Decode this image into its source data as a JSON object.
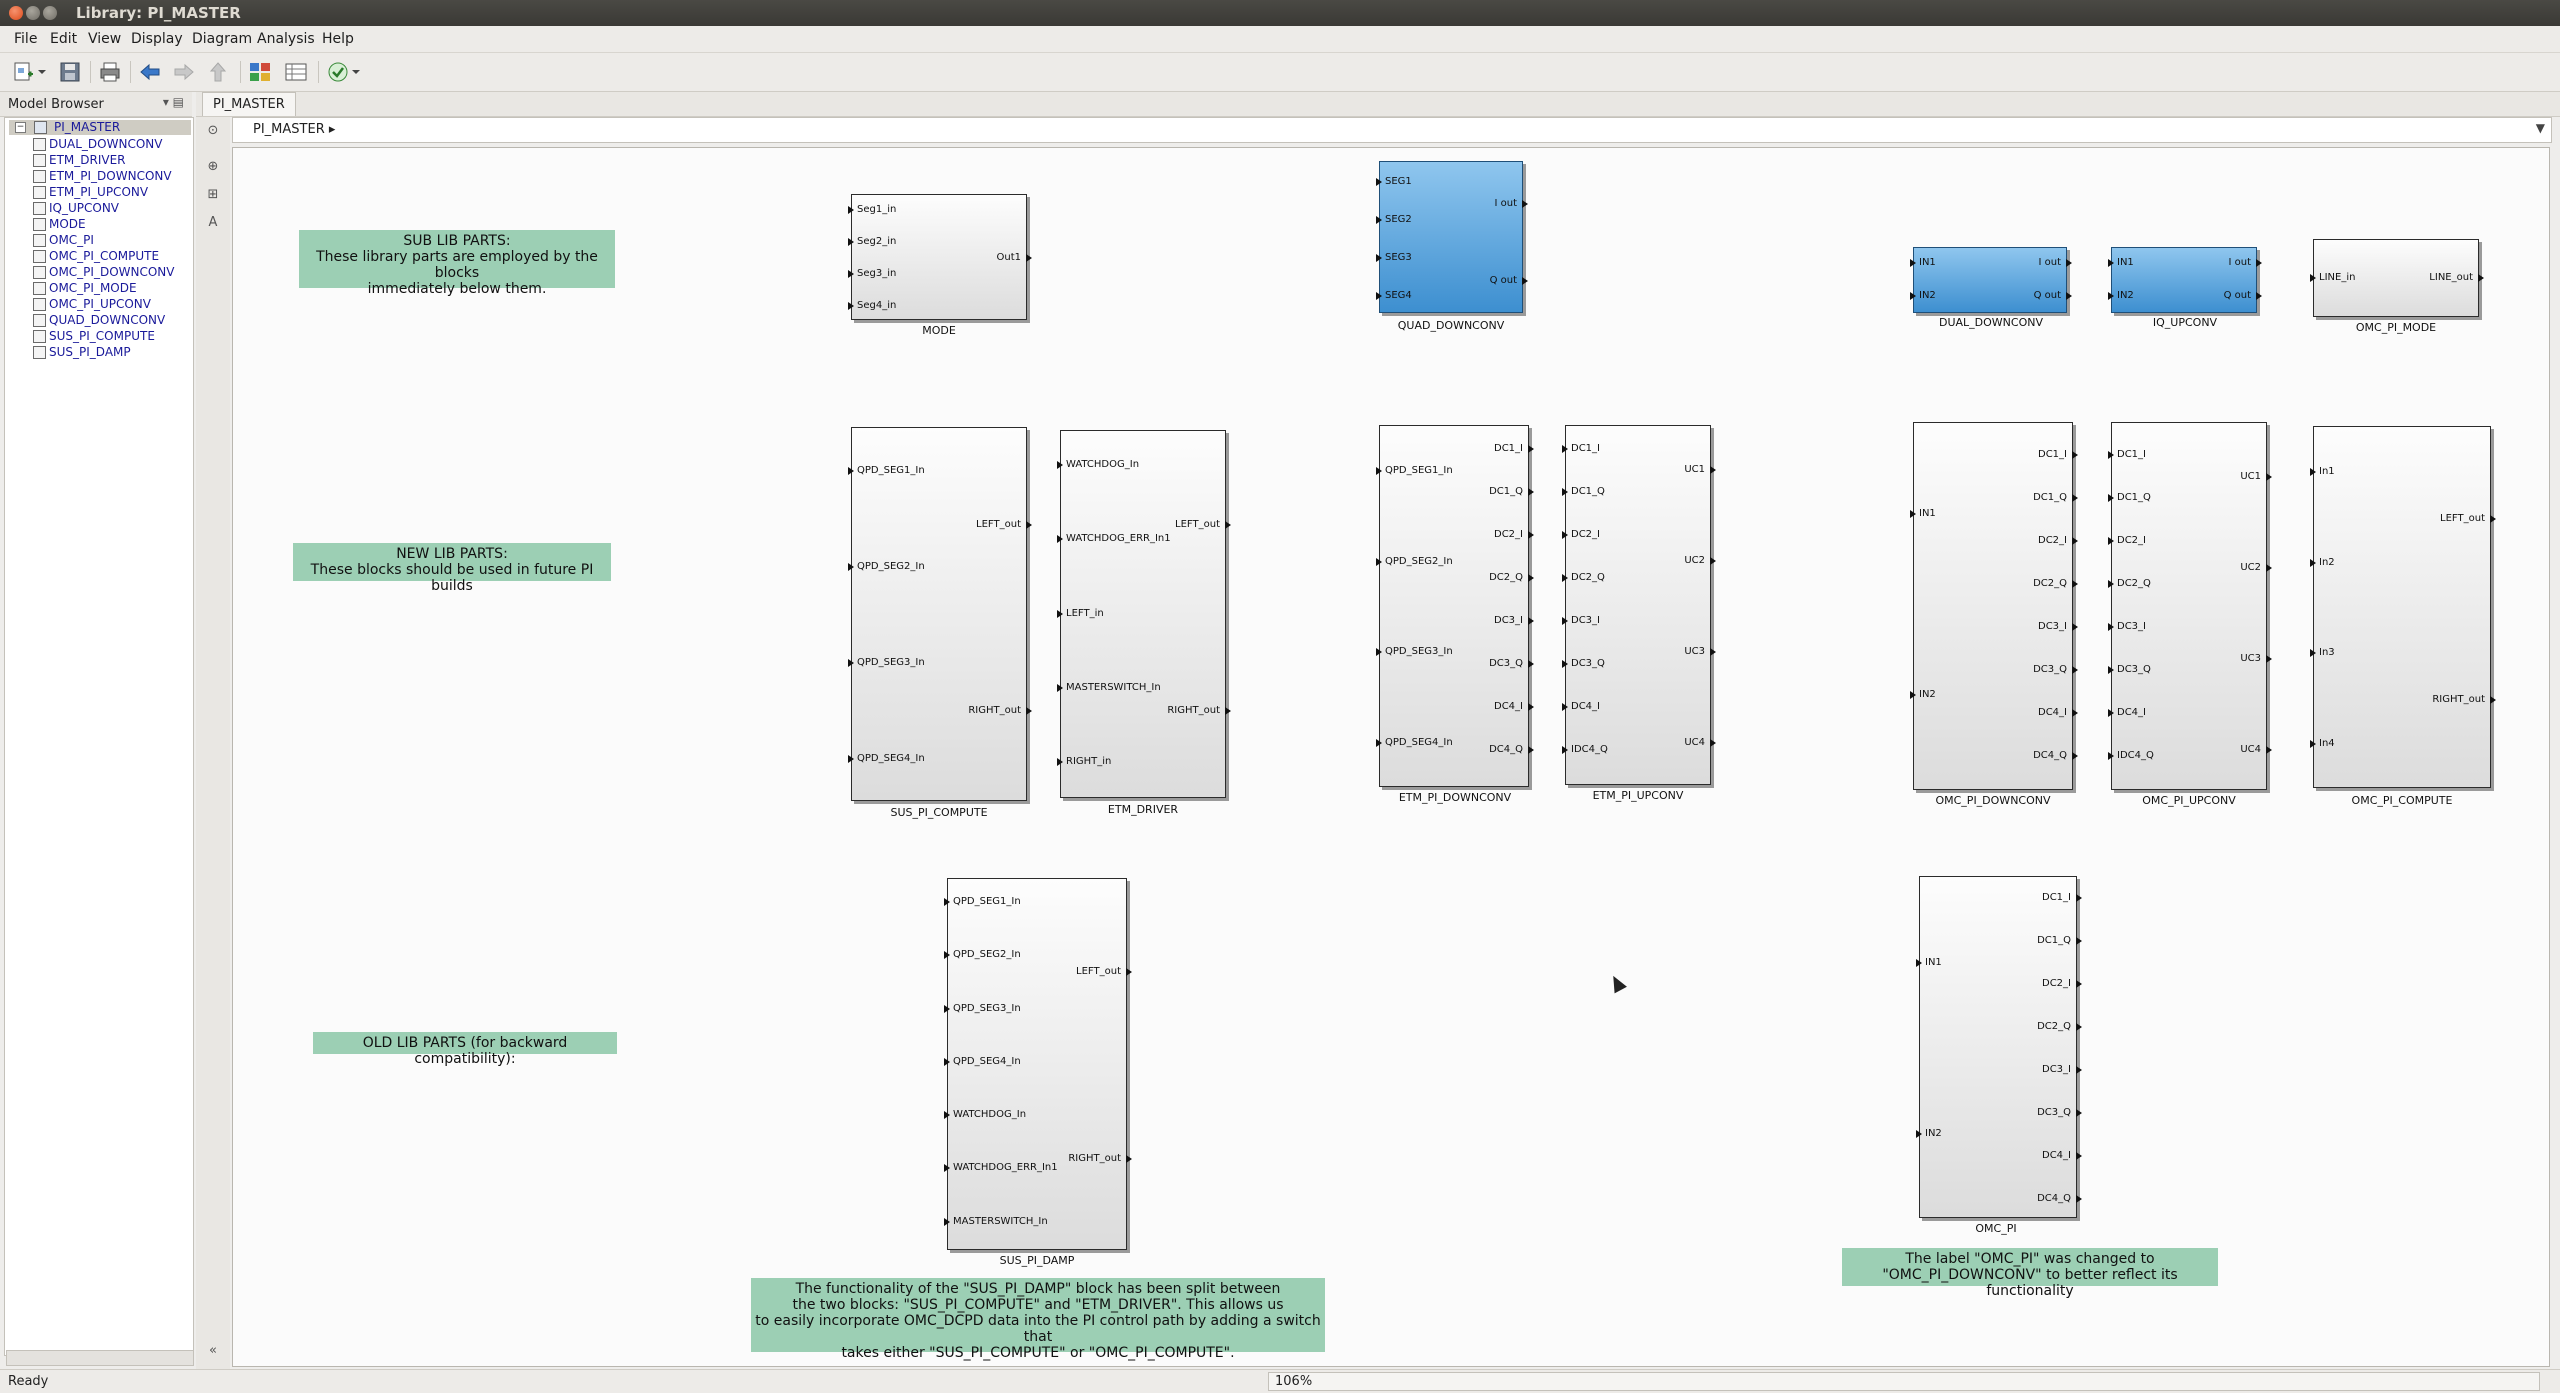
{
  "window": {
    "title": "Library: PI_MASTER"
  },
  "menu": [
    "File",
    "Edit",
    "View",
    "Display",
    "Diagram",
    "Analysis",
    "Help"
  ],
  "browser": {
    "header": "Model Browser",
    "root": "PI_MASTER",
    "items": [
      "DUAL_DOWNCONV",
      "ETM_DRIVER",
      "ETM_PI_DOWNCONV",
      "ETM_PI_UPCONV",
      "IQ_UPCONV",
      "MODE",
      "OMC_PI",
      "OMC_PI_COMPUTE",
      "OMC_PI_DOWNCONV",
      "OMC_PI_MODE",
      "OMC_PI_UPCONV",
      "QUAD_DOWNCONV",
      "SUS_PI_COMPUTE",
      "SUS_PI_DAMP"
    ]
  },
  "tab": {
    "label": "PI_MASTER"
  },
  "address": {
    "path": "PI_MASTER"
  },
  "annotations": {
    "sub": {
      "title": "SUB LIB PARTS:",
      "line1": "These library parts are employed by the blocks",
      "line2": "immediately below them."
    },
    "new": {
      "title": "NEW LIB PARTS:",
      "line1": "These blocks should be used in future PI builds"
    },
    "old": {
      "title": "OLD LIB PARTS (for backward compatibility):"
    },
    "sus_note": {
      "line1": "The functionality of the \"SUS_PI_DAMP\" block has been split between",
      "line2": "the two blocks: \"SUS_PI_COMPUTE\" and \"ETM_DRIVER\". This allows us",
      "line3": "to easily incorporate OMC_DCPD data into the PI control path by adding a switch that",
      "line4": "takes either \"SUS_PI_COMPUTE\"  or \"OMC_PI_COMPUTE\"."
    },
    "omc_note": {
      "line1": "The label \"OMC_PI\" was changed to",
      "line2": "\"OMC_PI_DOWNCONV\" to better reflect its functionality"
    }
  },
  "blocks": {
    "mode": {
      "name": "MODE",
      "inputs": [
        "Seg1_in",
        "Seg2_in",
        "Seg3_in",
        "Seg4_in"
      ],
      "outputs": [
        "Out1"
      ]
    },
    "quad_downconv": {
      "name": "QUAD_DOWNCONV",
      "inputs": [
        "SEG1",
        "SEG2",
        "SEG3",
        "SEG4"
      ],
      "outputs": [
        "I out",
        "Q out"
      ]
    },
    "dual_downconv": {
      "name": "DUAL_DOWNCONV",
      "inputs": [
        "IN1",
        "IN2"
      ],
      "outputs": [
        "I out",
        "Q out"
      ]
    },
    "iq_upconv": {
      "name": "IQ_UPCONV",
      "inputs": [
        "IN1",
        "IN2"
      ],
      "outputs": [
        "I out",
        "Q out"
      ]
    },
    "omc_pi_mode": {
      "name": "OMC_PI_MODE",
      "inputs": [
        "LINE_in"
      ],
      "outputs": [
        "LINE_out"
      ]
    },
    "sus_pi_compute": {
      "name": "SUS_PI_COMPUTE",
      "inputs": [
        "QPD_SEG1_In",
        "QPD_SEG2_In",
        "QPD_SEG3_In",
        "QPD_SEG4_In"
      ],
      "outputs": [
        "LEFT_out",
        "RIGHT_out"
      ]
    },
    "etm_driver": {
      "name": "ETM_DRIVER",
      "inputs": [
        "WATCHDOG_In",
        "WATCHDOG_ERR_In1",
        "LEFT_in",
        "MASTERSWITCH_In",
        "RIGHT_in"
      ],
      "outputs": [
        "LEFT_out",
        "RIGHT_out"
      ]
    },
    "etm_pi_downconv": {
      "name": "ETM_PI_DOWNCONV",
      "inputs": [
        "QPD_SEG1_In",
        "QPD_SEG2_In",
        "QPD_SEG3_In",
        "QPD_SEG4_In"
      ],
      "outputs": [
        "DC1_I",
        "DC1_Q",
        "DC2_I",
        "DC2_Q",
        "DC3_I",
        "DC3_Q",
        "DC4_I",
        "DC4_Q"
      ]
    },
    "etm_pi_upconv": {
      "name": "ETM_PI_UPCONV",
      "inputs": [
        "DC1_I",
        "DC1_Q",
        "DC2_I",
        "DC2_Q",
        "DC3_I",
        "DC3_Q",
        "DC4_I",
        "IDC4_Q"
      ],
      "outputs": [
        "UC1",
        "UC2",
        "UC3",
        "UC4"
      ]
    },
    "omc_pi_downconv": {
      "name": "OMC_PI_DOWNCONV",
      "inputs": [
        "IN1",
        "IN2"
      ],
      "outputs": [
        "DC1_I",
        "DC1_Q",
        "DC2_I",
        "DC2_Q",
        "DC3_I",
        "DC3_Q",
        "DC4_I",
        "DC4_Q"
      ]
    },
    "omc_pi_upconv": {
      "name": "OMC_PI_UPCONV",
      "inputs": [
        "DC1_I",
        "DC1_Q",
        "DC2_I",
        "DC2_Q",
        "DC3_I",
        "DC3_Q",
        "DC4_I",
        "IDC4_Q"
      ],
      "outputs": [
        "UC1",
        "UC2",
        "UC3",
        "UC4"
      ]
    },
    "omc_pi_compute": {
      "name": "OMC_PI_COMPUTE",
      "inputs": [
        "In1",
        "In2",
        "In3",
        "In4"
      ],
      "outputs": [
        "LEFT_out",
        "RIGHT_out"
      ]
    },
    "sus_pi_damp": {
      "name": "SUS_PI_DAMP",
      "inputs": [
        "QPD_SEG1_In",
        "QPD_SEG2_In",
        "QPD_SEG3_In",
        "QPD_SEG4_In",
        "WATCHDOG_In",
        "WATCHDOG_ERR_In1",
        "MASTERSWITCH_In"
      ],
      "outputs": [
        "LEFT_out",
        "RIGHT_out"
      ]
    },
    "omc_pi": {
      "name": "OMC_PI",
      "inputs": [
        "IN1",
        "IN2"
      ],
      "outputs": [
        "DC1_I",
        "DC1_Q",
        "DC2_I",
        "DC2_Q",
        "DC3_I",
        "DC3_Q",
        "DC4_I",
        "DC4_Q"
      ]
    }
  },
  "status": {
    "text": "Ready",
    "zoom": "106%"
  },
  "colors": {
    "annotation_bg": "#9ccfb4",
    "blue_block": "#3d8fd0",
    "canvas": "#fbfbfb"
  }
}
